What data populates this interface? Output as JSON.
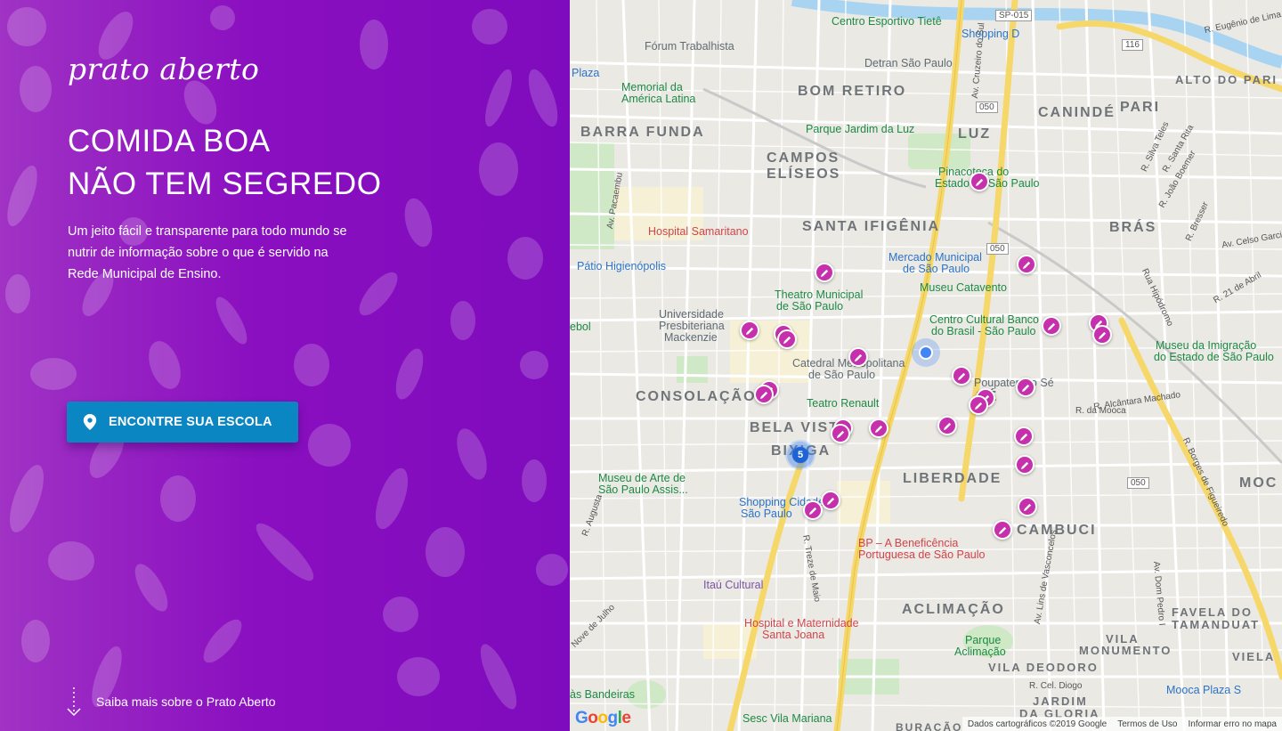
{
  "hero": {
    "logo": "prato aberto",
    "headline_line1": "COMIDA BOA",
    "headline_line2": "NÃO TEM SEGREDO",
    "lead": "Um jeito fácil e transparente para todo mundo se nutrir de informação sobre o que é servido na Rede Municipal de Ensino.",
    "cta_label": "ENCONTRE SUA ESCOLA",
    "more_label": "Saiba mais sobre o Prato Aberto"
  },
  "colors": {
    "panel_purple": "#8a0fc0",
    "cta_blue": "#0a86c3",
    "marker_magenta": "#c630ac"
  },
  "map": {
    "neighborhoods": [
      "BOM RETIRO",
      "BARRA FUNDA",
      "CAMPOS",
      "ELÍSEOS",
      "LUZ",
      "CANINDÉ",
      "PARI",
      "ALTO DO PARI",
      "SANTA IFIGÊNIA",
      "BRÁS",
      "CONSOLAÇÃO",
      "BELA VISTA",
      "BIXIGA",
      "SÉ",
      "LIBERDADE",
      "CAMBUCI",
      "ACLIMAÇÃO",
      "VILA",
      "MONUMENTO",
      "VILA DEODORO",
      "JARDIM",
      "DA GLORIA",
      "FAVELA DO",
      "TAMANDUAT",
      "VIELA",
      "MOC",
      "BURAÇÃO"
    ],
    "pois": [
      "Centro Esportivo Tietê",
      "Fórum Trabalhista",
      "Shopping D",
      "Detran São Paulo",
      "Memorial da",
      "América Latina",
      "Parque Jardim da Luz",
      "Pinacoteca do",
      "Estado de São Paulo",
      "Hospital Samaritano",
      "Pátio Higienópolis",
      "Mercado Municipal",
      "de São Paulo",
      "Museu Catavento",
      "Theatro Municipal",
      "de São Paulo",
      "Universidade",
      "Presbiteriana",
      "Mackenzie",
      "Centro Cultural Banco",
      "do Brasil - São Paulo",
      "Catedral Metropolitana",
      "de São Paulo",
      "Poupatempo Sé",
      "Museu da Imigração",
      "do Estado de São Paulo",
      "Teatro Renault",
      "Museu de Arte de",
      "São Paulo Assis...",
      "Shopping Cidade",
      "São Paulo",
      "BP – A Beneficência",
      "Portuguesa de São Paulo",
      "Itaú Cultural",
      "Hospital e Maternidade",
      "Santa Joana",
      "Parque",
      "Aclimação",
      "Sesc Vila Mariana",
      "às Bandeiras",
      "Mooca Plaza S",
      "Plaza",
      "ebol"
    ],
    "streets": [
      "SP-015",
      "116",
      "050",
      "050",
      "050",
      "Av. Cruzeiro do Sul",
      "R. Silva Teles",
      "R. Santa Rita",
      "R. João Boemer",
      "R. Bresser",
      "Av. Celso Garcia",
      "R. 21 de Abril",
      "Rua Hipódromo",
      "R. Alcântara Machado",
      "R. da Mooca",
      "R. Borges de Figueiredo",
      "Av. Pacaembu",
      "R. Augusta",
      "R. Treze de Maio",
      "Av. Lins de Vasconcelos",
      "Av. Dom Pedro I",
      "R. Cel. Diogo",
      "Nove de Julho",
      "R. Eugênio de Lima"
    ],
    "cluster_count": "5",
    "google_logo": "Google",
    "attribution": "Dados cartográficos ©2019 Google",
    "terms": "Termos de Uso",
    "report": "Informar erro no mapa"
  }
}
